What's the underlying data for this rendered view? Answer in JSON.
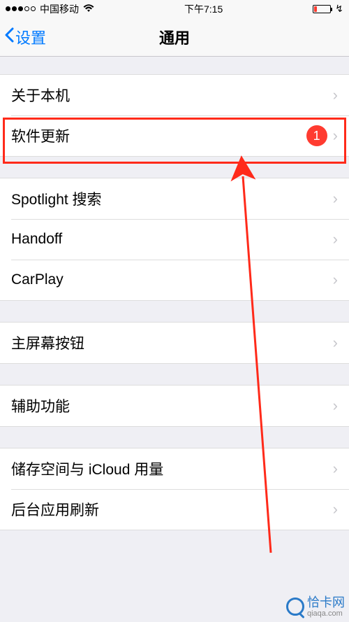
{
  "status": {
    "carrier": "中国移动",
    "time": "下午7:15",
    "charging_symbol": "↯"
  },
  "nav": {
    "back_label": "设置",
    "title": "通用"
  },
  "groups": [
    {
      "items": [
        {
          "label": "关于本机",
          "badge": null
        },
        {
          "label": "软件更新",
          "badge": "1"
        }
      ]
    },
    {
      "items": [
        {
          "label": "Spotlight 搜索",
          "badge": null
        },
        {
          "label": "Handoff",
          "badge": null
        },
        {
          "label": "CarPlay",
          "badge": null
        }
      ]
    },
    {
      "items": [
        {
          "label": "主屏幕按钮",
          "badge": null
        }
      ]
    },
    {
      "items": [
        {
          "label": "辅助功能",
          "badge": null
        }
      ]
    },
    {
      "items": [
        {
          "label": "储存空间与 iCloud 用量",
          "badge": null
        },
        {
          "label": "后台应用刷新",
          "badge": null
        }
      ]
    }
  ],
  "watermark": {
    "name": "恰卡网",
    "url": "qiaqa.com"
  }
}
